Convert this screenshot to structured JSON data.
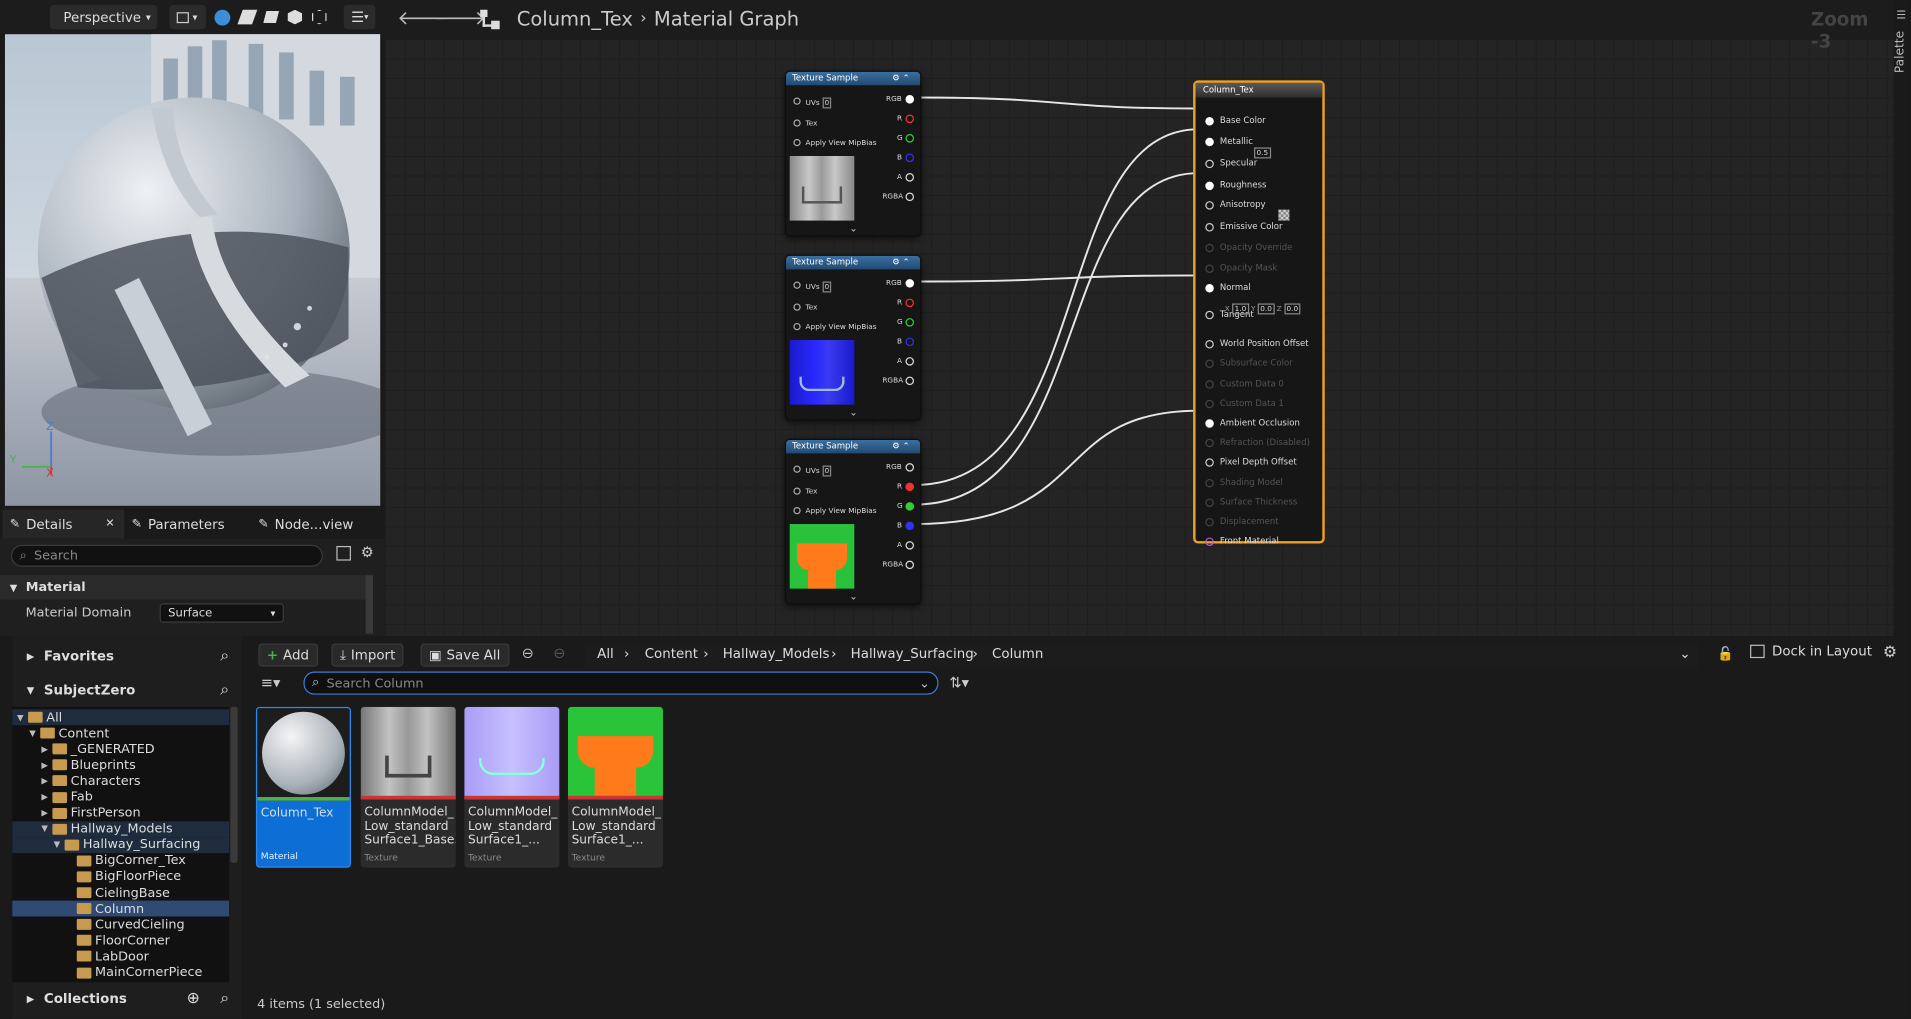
{
  "viewport": {
    "mode_label": "Perspective",
    "axis_z": "Z",
    "axis_y": "Y",
    "axis_x": "X"
  },
  "detail_tabs": [
    {
      "label": "Details",
      "close": "✕"
    },
    {
      "label": "Parameters"
    },
    {
      "label": "Node...view"
    }
  ],
  "details": {
    "search_placeholder": "Search",
    "section": "Material",
    "domain_label": "Material Domain",
    "domain_value": "Surface"
  },
  "graph": {
    "breadcrumb": [
      "Column_Tex",
      "Material Graph"
    ],
    "zoom": "Zoom -3",
    "palette": "Palette",
    "texture_nodes": [
      {
        "title": "Texture Sample",
        "uv_value": "0"
      },
      {
        "title": "Texture Sample",
        "uv_value": "0"
      },
      {
        "title": "Texture Sample",
        "uv_value": "0"
      }
    ],
    "texture_inputs": [
      "UVs",
      "Tex",
      "Apply View MipBias"
    ],
    "texture_outputs": [
      "RGB",
      "R",
      "G",
      "B",
      "A",
      "RGBA"
    ],
    "result_node": {
      "title": "Column_Tex",
      "specular_value": "0.5",
      "tangent": {
        "x_label": "X",
        "x": "1.0",
        "y_label": "Y",
        "y": "0.0",
        "z_label": "Z",
        "z": "0.0"
      },
      "pins": [
        {
          "label": "Base Color",
          "state": "connected"
        },
        {
          "label": "Metallic",
          "state": "connected"
        },
        {
          "label": "Specular",
          "state": "open"
        },
        {
          "label": "Roughness",
          "state": "connected"
        },
        {
          "label": "Anisotropy",
          "state": "open"
        },
        {
          "label": "Emissive Color",
          "state": "open"
        },
        {
          "label": "Opacity Override",
          "state": "disabled"
        },
        {
          "label": "Opacity Mask",
          "state": "disabled"
        },
        {
          "label": "Normal",
          "state": "connected"
        },
        {
          "label": "Tangent",
          "state": "open"
        },
        {
          "label": "World Position Offset",
          "state": "open"
        },
        {
          "label": "Subsurface Color",
          "state": "disabled"
        },
        {
          "label": "Custom Data 0",
          "state": "disabled"
        },
        {
          "label": "Custom Data 1",
          "state": "disabled"
        },
        {
          "label": "Ambient Occlusion",
          "state": "connected"
        },
        {
          "label": "Refraction (Disabled)",
          "state": "disabled"
        },
        {
          "label": "Pixel Depth Offset",
          "state": "open"
        },
        {
          "label": "Shading Model",
          "state": "disabled"
        },
        {
          "label": "Surface Thickness",
          "state": "disabled"
        },
        {
          "label": "Displacement",
          "state": "disabled"
        },
        {
          "label": "Front Material",
          "state": "open"
        }
      ]
    }
  },
  "content_browser": {
    "favorites": "Favorites",
    "project": "SubjectZero",
    "collections": "Collections",
    "add": "Add",
    "import": "Import",
    "save_all": "Save All",
    "path": [
      "All",
      "Content",
      "Hallway_Models",
      "Hallway_Surfacing",
      "Column"
    ],
    "search_placeholder": "Search Column",
    "dock": "Dock in Layout",
    "status": "4 items (1 selected)",
    "tree": [
      {
        "label": "All",
        "level": 0,
        "open": true
      },
      {
        "label": "Content",
        "level": 1,
        "open": true
      },
      {
        "label": "_GENERATED",
        "level": 2,
        "open": false
      },
      {
        "label": "Blueprints",
        "level": 2,
        "open": false
      },
      {
        "label": "Characters",
        "level": 2,
        "open": false
      },
      {
        "label": "Fab",
        "level": 2,
        "open": false
      },
      {
        "label": "FirstPerson",
        "level": 2,
        "open": false
      },
      {
        "label": "Hallway_Models",
        "level": 2,
        "open": true
      },
      {
        "label": "Hallway_Surfacing",
        "level": 3,
        "open": true
      },
      {
        "label": "BigCorner_Tex",
        "level": 4
      },
      {
        "label": "BigFloorPiece",
        "level": 4
      },
      {
        "label": "CielingBase",
        "level": 4
      },
      {
        "label": "Column",
        "level": 4,
        "selected": true
      },
      {
        "label": "CurvedCieling",
        "level": 4
      },
      {
        "label": "FloorCorner",
        "level": 4
      },
      {
        "label": "LabDoor",
        "level": 4
      },
      {
        "label": "MainCornerPiece",
        "level": 4
      }
    ],
    "assets": [
      {
        "name": "Column_Tex",
        "type": "Material",
        "selected": true
      },
      {
        "name": "ColumnModel_\nLow_standard\nSurface1_Base...",
        "type": "Texture"
      },
      {
        "name": "ColumnModel_\nLow_standard\nSurface1_...",
        "type": "Texture"
      },
      {
        "name": "ColumnModel_\nLow_standard\nSurface1_...",
        "type": "Texture"
      }
    ]
  }
}
